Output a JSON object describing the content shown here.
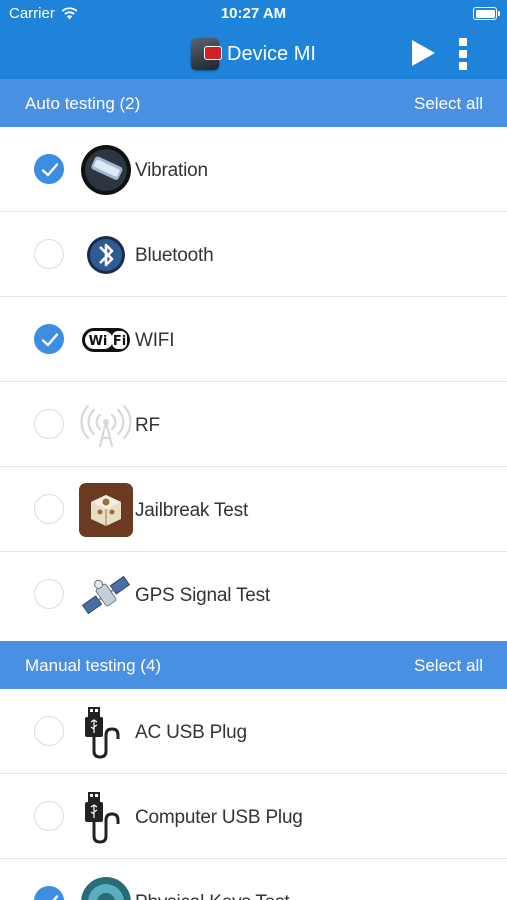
{
  "status_bar": {
    "carrier": "Carrier",
    "time": "10:27 AM"
  },
  "nav": {
    "title": "Device MI"
  },
  "sections": [
    {
      "title": "Auto testing (2)",
      "select_all": "Select all",
      "items": [
        {
          "label": "Vibration",
          "checked": true,
          "icon": "vibration-icon"
        },
        {
          "label": "Bluetooth",
          "checked": false,
          "icon": "bluetooth-icon"
        },
        {
          "label": "WIFI",
          "checked": true,
          "icon": "wifi-icon"
        },
        {
          "label": "RF",
          "checked": false,
          "icon": "antenna-icon"
        },
        {
          "label": "Jailbreak Test",
          "checked": false,
          "icon": "jailbreak-box-icon"
        },
        {
          "label": "GPS Signal Test",
          "checked": false,
          "icon": "satellite-icon"
        }
      ]
    },
    {
      "title": "Manual testing (4)",
      "select_all": "Select all",
      "items": [
        {
          "label": "AC USB Plug",
          "checked": false,
          "icon": "usb-plug-icon"
        },
        {
          "label": "Computer USB Plug",
          "checked": false,
          "icon": "usb-plug-icon"
        },
        {
          "label": "Physical Keys Test",
          "checked": true,
          "icon": "keys-icon"
        }
      ]
    }
  ],
  "colors": {
    "nav_bar": "#1e83d9",
    "section_header": "#4a90e2",
    "checkbox_on": "#3d8ee3"
  }
}
